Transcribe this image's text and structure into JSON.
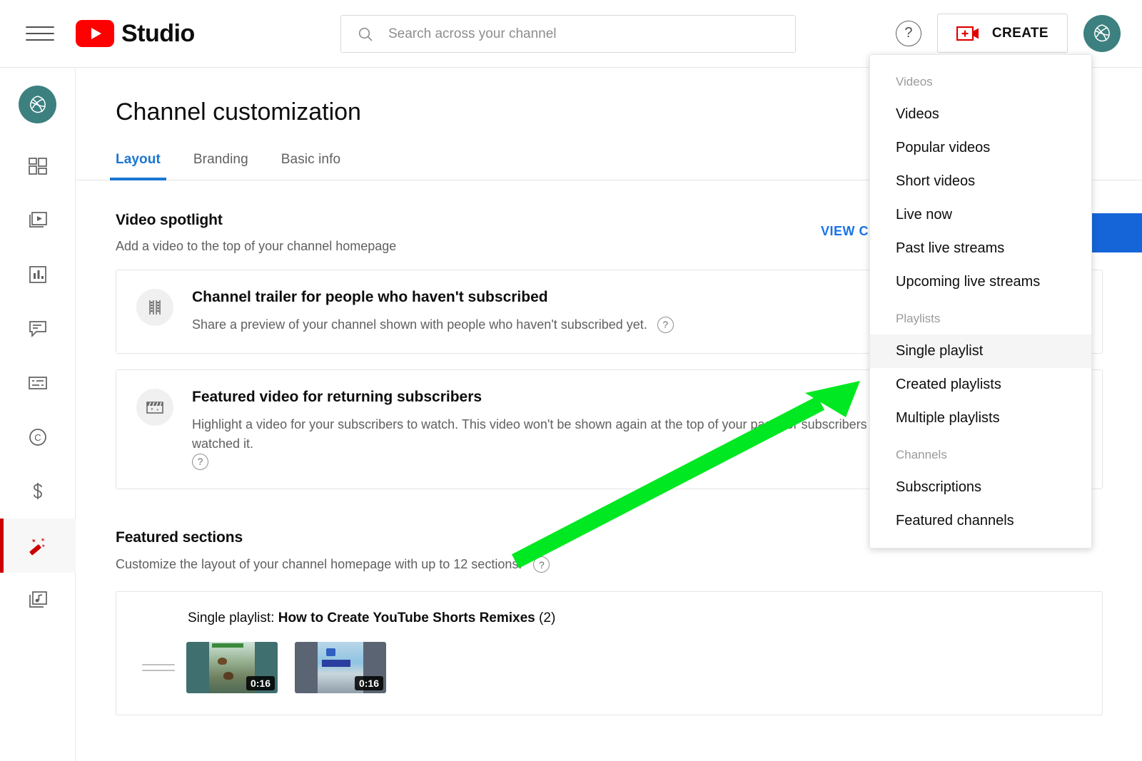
{
  "topbar": {
    "menu_icon": "hamburger-icon",
    "brand": "Studio",
    "search_placeholder": "Search across your channel",
    "search_value": "",
    "help_label": "?",
    "create_label": "CREATE",
    "create_icon": "video-plus-icon",
    "avatar_icon": "channel-avatar"
  },
  "sidebar": {
    "items": [
      {
        "name": "channel-avatar",
        "label": "Your channel"
      },
      {
        "name": "dashboard-icon",
        "label": "Dashboard"
      },
      {
        "name": "content-icon",
        "label": "Content"
      },
      {
        "name": "analytics-icon",
        "label": "Analytics"
      },
      {
        "name": "comments-icon",
        "label": "Comments"
      },
      {
        "name": "subtitles-icon",
        "label": "Subtitles"
      },
      {
        "name": "copyright-icon",
        "label": "Copyright"
      },
      {
        "name": "monetization-icon",
        "label": "Earn"
      },
      {
        "name": "customization-icon",
        "label": "Customization"
      },
      {
        "name": "audio-library-icon",
        "label": "Audio library"
      }
    ],
    "active_index": 8
  },
  "page": {
    "title": "Channel customization",
    "tabs": [
      {
        "label": "Layout",
        "active": true
      },
      {
        "label": "Branding",
        "active": false
      },
      {
        "label": "Basic info",
        "active": false
      }
    ],
    "view_channel": "VIEW CHANNEL",
    "publish_label": ""
  },
  "video_spotlight": {
    "heading": "Video spotlight",
    "subheading": "Add a video to the top of your channel homepage",
    "cards": [
      {
        "icon": "film-strip-icon",
        "title": "Channel trailer for people who haven't subscribed",
        "desc": "Share a preview of your channel shown with people who haven't subscribed yet.",
        "help": "?"
      },
      {
        "icon": "clapperboard-sparkle-icon",
        "title": "Featured video for returning subscribers",
        "desc": "Highlight a video for your subscribers to watch. This video won't be shown again at the top of your page for subscribers who have already watched it.",
        "help": "?"
      }
    ]
  },
  "featured_sections": {
    "heading": "Featured sections",
    "subheading": "Customize the layout of your channel homepage with up to 12 sections.",
    "help": "?",
    "rows": [
      {
        "prefix": "Single playlist:",
        "name": "How to Create YouTube Shorts Remixes",
        "count": "(2)",
        "drag_handle": "drag-handle-icon",
        "thumbnails": [
          {
            "duration": "0:16",
            "bg": "#3f6f6f",
            "inner_top": "#d8e8e0",
            "inner_bottom": "#6a7a5a"
          },
          {
            "duration": "0:16",
            "bg": "#5a6472",
            "inner_top": "#8fc4e2",
            "inner_bottom": "#b9cdd8"
          }
        ]
      }
    ]
  },
  "create_menu": {
    "groups": [
      {
        "label": "Videos",
        "items": [
          {
            "label": "Videos",
            "hovered": false
          },
          {
            "label": "Popular videos",
            "hovered": false
          },
          {
            "label": "Short videos",
            "hovered": false
          },
          {
            "label": "Live now",
            "hovered": false
          },
          {
            "label": "Past live streams",
            "hovered": false
          },
          {
            "label": "Upcoming live streams",
            "hovered": false
          }
        ]
      },
      {
        "label": "Playlists",
        "items": [
          {
            "label": "Single playlist",
            "hovered": true
          },
          {
            "label": "Created playlists",
            "hovered": false
          },
          {
            "label": "Multiple playlists",
            "hovered": false
          }
        ]
      },
      {
        "label": "Channels",
        "items": [
          {
            "label": "Subscriptions",
            "hovered": false
          },
          {
            "label": "Featured channels",
            "hovered": false
          }
        ]
      }
    ]
  },
  "annotation": {
    "type": "arrow",
    "color": "#00e822",
    "points_to": "Single playlist"
  },
  "colors": {
    "youtube_red": "#ff0000",
    "accent_blue": "#1976d2",
    "avatar_teal": "#3d8080",
    "active_rail": "#cc0000"
  }
}
